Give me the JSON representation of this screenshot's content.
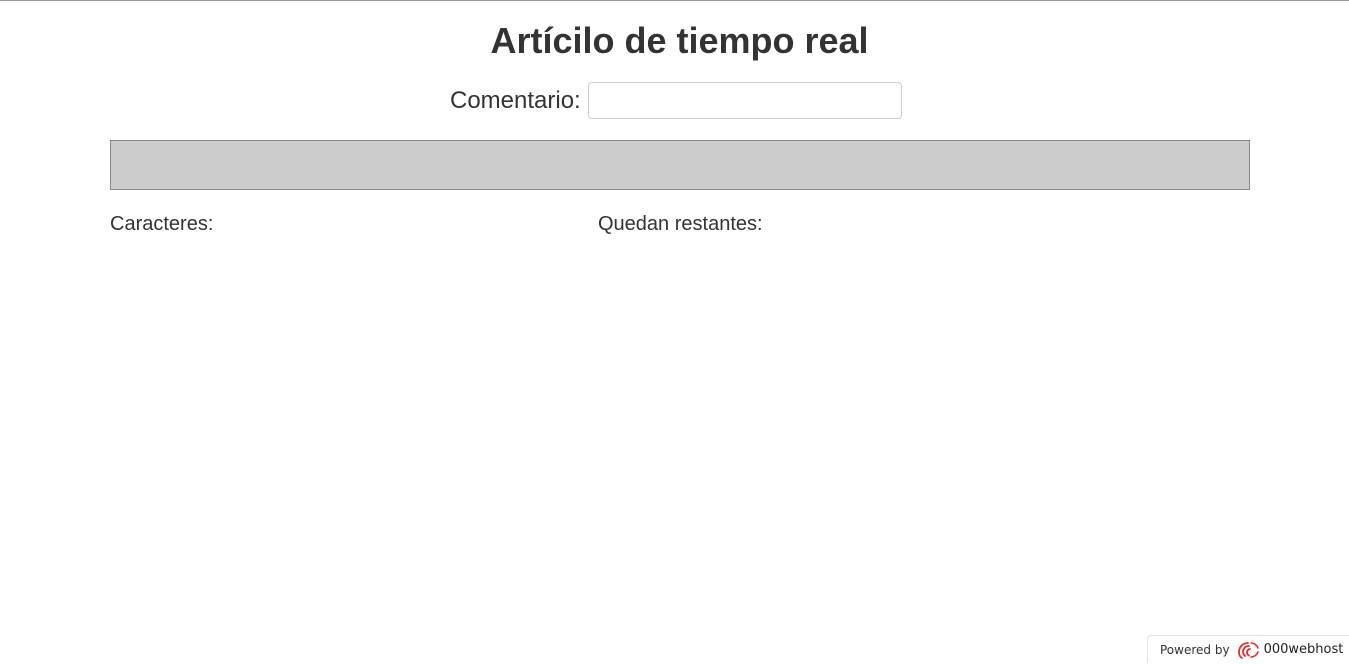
{
  "page": {
    "title": "Artícilo de tiempo real"
  },
  "form": {
    "comment_label": "Comentario:",
    "comment_value": "",
    "comment_placeholder": ""
  },
  "stats": {
    "characters_label": "Caracteres:",
    "remaining_label": "Quedan restantes:"
  },
  "footer": {
    "powered_by": "Powered by",
    "brand": "000webhost",
    "logo_icon": "000webhost-logo-icon",
    "logo_color": "#e52b2b"
  },
  "colors": {
    "preview_background": "#cccccc",
    "text": "#333333"
  }
}
